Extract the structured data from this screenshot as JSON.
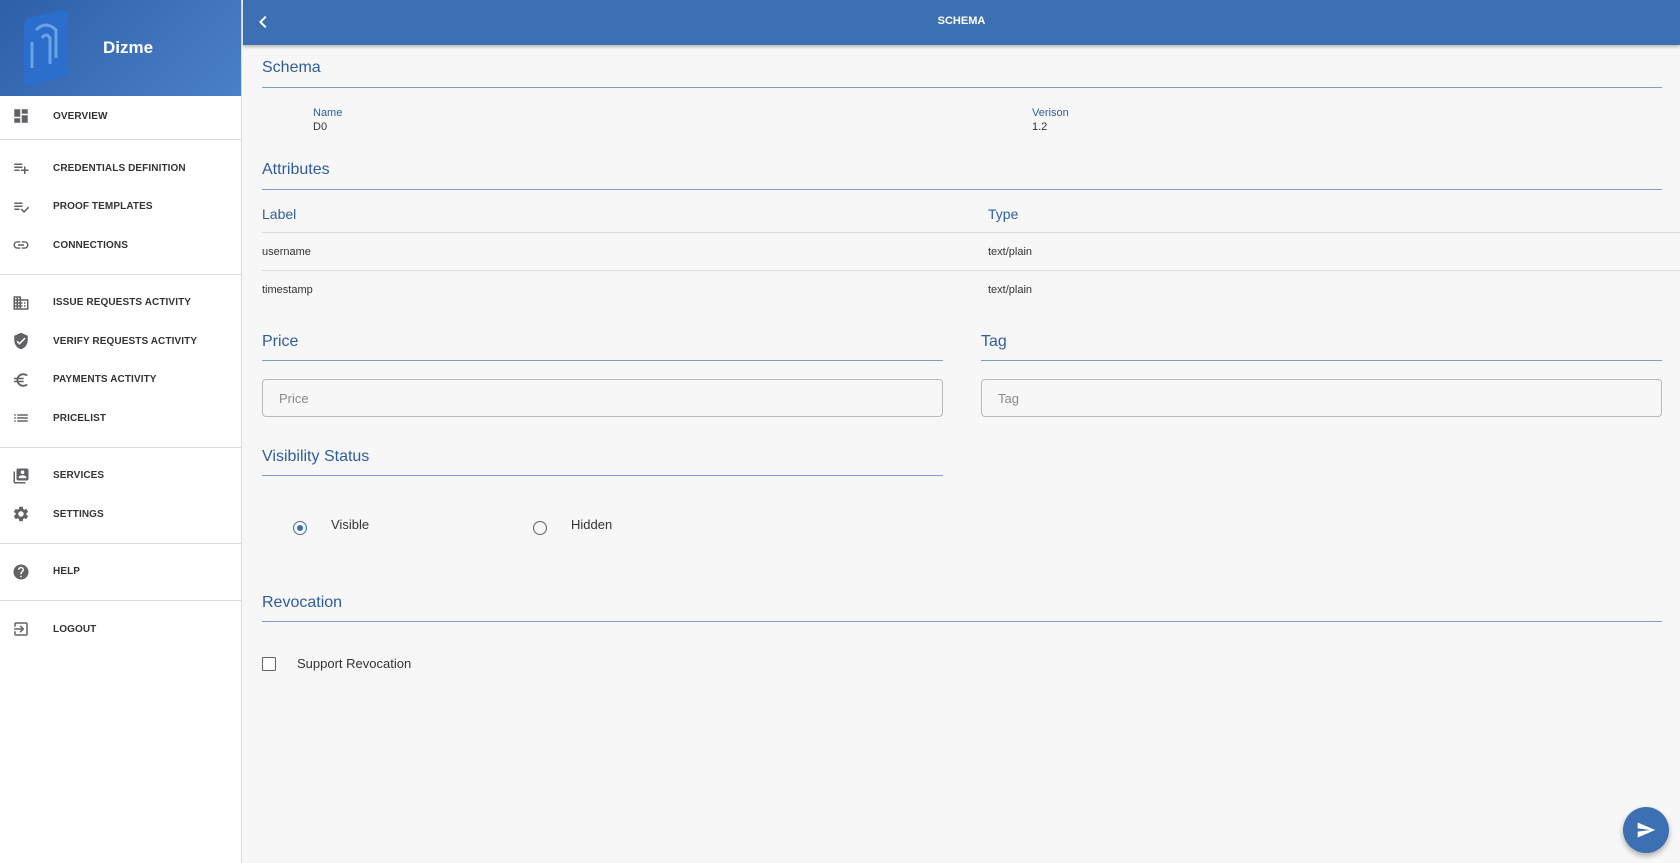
{
  "app": {
    "name": "Dizme"
  },
  "topbar": {
    "title": "SCHEMA"
  },
  "sidebar": {
    "items": [
      {
        "label": "OVERVIEW",
        "icon": "dashboard-icon"
      },
      {
        "label": "CREDENTIALS DEFINITION",
        "icon": "playlist-add-icon"
      },
      {
        "label": "PROOF TEMPLATES",
        "icon": "playlist-check-icon"
      },
      {
        "label": "CONNECTIONS",
        "icon": "link-icon"
      },
      {
        "label": "ISSUE REQUESTS ACTIVITY",
        "icon": "building-icon"
      },
      {
        "label": "VERIFY REQUESTS ACTIVITY",
        "icon": "shield-check-icon"
      },
      {
        "label": "PAYMENTS ACTIVITY",
        "icon": "euro-icon"
      },
      {
        "label": "PRICELIST",
        "icon": "list-icon"
      },
      {
        "label": "SERVICES",
        "icon": "services-icon"
      },
      {
        "label": "SETTINGS",
        "icon": "gear-icon"
      },
      {
        "label": "HELP",
        "icon": "help-icon"
      },
      {
        "label": "LOGOUT",
        "icon": "logout-icon"
      }
    ]
  },
  "schema": {
    "title": "Schema",
    "name_label": "Name",
    "name_value": "D0",
    "version_label": "Verison",
    "version_value": "1.2"
  },
  "attributes": {
    "title": "Attributes",
    "headers": [
      "Label",
      "Type"
    ],
    "rows": [
      [
        "username",
        "text/plain"
      ],
      [
        "timestamp",
        "text/plain"
      ]
    ]
  },
  "price": {
    "title": "Price",
    "placeholder": "Price",
    "value": ""
  },
  "tag": {
    "title": "Tag",
    "placeholder": "Tag",
    "value": ""
  },
  "visibility": {
    "title": "Visibility Status",
    "options": [
      "Visible",
      "Hidden"
    ],
    "selected": "Visible"
  },
  "revocation": {
    "title": "Revocation",
    "checkbox_label": "Support Revocation",
    "checked": false
  },
  "colors": {
    "primary": "#3d6fb3",
    "accent_text": "#2f5d9c"
  }
}
